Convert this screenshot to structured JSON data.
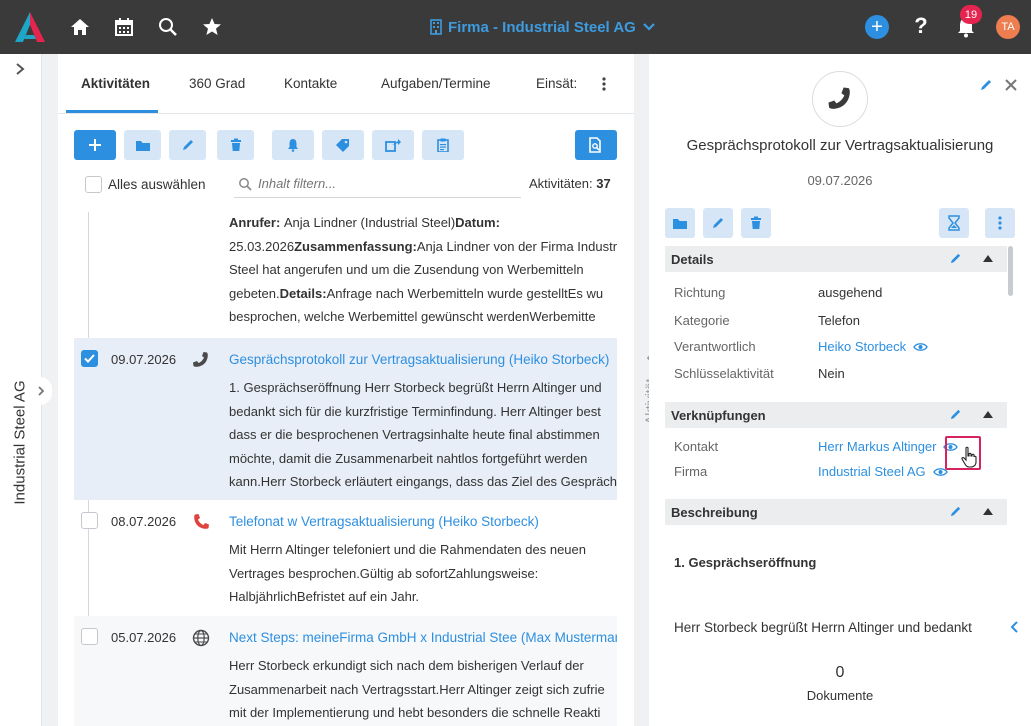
{
  "header": {
    "title": "Firma - Industrial Steel AG",
    "notifications": "19",
    "avatar": "TA"
  },
  "sidebar": {
    "company": "Industrial Steel AG"
  },
  "tabs": [
    {
      "label": "Aktivitäten"
    },
    {
      "label": "360 Grad"
    },
    {
      "label": "Kontakte"
    },
    {
      "label": "Aufgaben/Termine"
    },
    {
      "label": "Einsät:"
    }
  ],
  "list": {
    "select_all": "Alles auswählen",
    "filter_placeholder": "Inhalt filtern...",
    "count_label": "Aktivitäten:",
    "count_value": "37",
    "first_body": [
      {
        "parts": [
          [
            "b",
            "Anrufer: "
          ],
          [
            "t",
            "Anja Lindner (Industrial Steel)"
          ],
          [
            "b",
            "Datum:"
          ]
        ]
      },
      {
        "parts": [
          [
            "t",
            "25.03.2026"
          ],
          [
            "b",
            "Zusammenfassung:"
          ],
          [
            "t",
            "Anja Lindner von der Firma Industri"
          ]
        ]
      },
      {
        "parts": [
          [
            "t",
            "Steel hat angerufen und um die Zusendung von Werbemitteln"
          ]
        ]
      },
      {
        "parts": [
          [
            "t",
            "gebeten."
          ],
          [
            "b",
            "Details:"
          ],
          [
            "t",
            "Anfrage nach Werbemitteln wurde gestelltEs wu"
          ]
        ]
      },
      {
        "parts": [
          [
            "t",
            "besprochen, welche Werbemittel gewünscht werdenWerbemitte"
          ]
        ]
      }
    ],
    "entries": [
      {
        "date": "09.07.2026",
        "title": "Gesprächsprotokoll zur Vertragsaktualisierung (Heiko Storbeck)",
        "lines": [
          "1. Gesprächseröffnung Herr Storbeck begrüßt Herrn Altinger und",
          "bedankt sich für die kurzfristige Terminfindung. Herr Altinger best",
          "dass er die besprochenen Vertragsinhalte heute final abstimmen",
          "möchte, damit die Zusammenarbeit nahtlos fortgeführt werden",
          "kann.Herr Storbeck erläutert eingangs, dass das Ziel des Gesprächs"
        ]
      },
      {
        "date": "08.07.2026",
        "title": "Telefonat w Vertragsaktualisierung (Heiko Storbeck)",
        "lines": [
          "Mit Herrn Altinger telefoniert und die Rahmendaten des neuen",
          "Vertrages besprochen.Gültig ab sofortZahlungsweise:",
          "HalbjährlichBefristet auf ein Jahr."
        ]
      },
      {
        "date": "05.07.2026",
        "title": "Next Steps: meineFirma GmbH x Industrial Stee (Max Mustermann)",
        "lines": [
          "Herr Storbeck erkundigt sich nach dem bisherigen Verlauf der",
          "Zusammenarbeit nach Vertragsstart.Herr Altinger zeigt sich zufrie",
          "mit der Implementierung und hebt besonders die schnelle Reakti"
        ]
      }
    ]
  },
  "splitter_label": "Aktivität",
  "detail": {
    "title": "Gesprächsprotokoll zur Vertragsaktualisierung",
    "date": "09.07.2026",
    "sections": {
      "details": "Details",
      "links": "Verknüpfungen",
      "description": "Beschreibung"
    },
    "fields": {
      "richtung_k": "Richtung",
      "richtung_v": "ausgehend",
      "kategorie_k": "Kategorie",
      "kategorie_v": "Telefon",
      "verantw_k": "Verantwortlich",
      "verantw_v": "Heiko Storbeck",
      "schluessel_k": "Schlüsselaktivität",
      "schluessel_v": "Nein",
      "kontakt_k": "Kontakt",
      "kontakt_v": "Herr Markus Altinger",
      "firma_k": "Firma",
      "firma_v": "Industrial Steel AG"
    },
    "desc_heading": "1. Gesprächseröffnung",
    "desc_text": "Herr Storbeck begrüßt Herrn Altinger und bedankt",
    "documents_count": "0",
    "documents_label": "Dokumente"
  },
  "colors": {
    "accent": "#2d8fe0",
    "topbar": "#3a3a3a",
    "highlight": "#d6245e",
    "call_red": "#e0423e"
  }
}
